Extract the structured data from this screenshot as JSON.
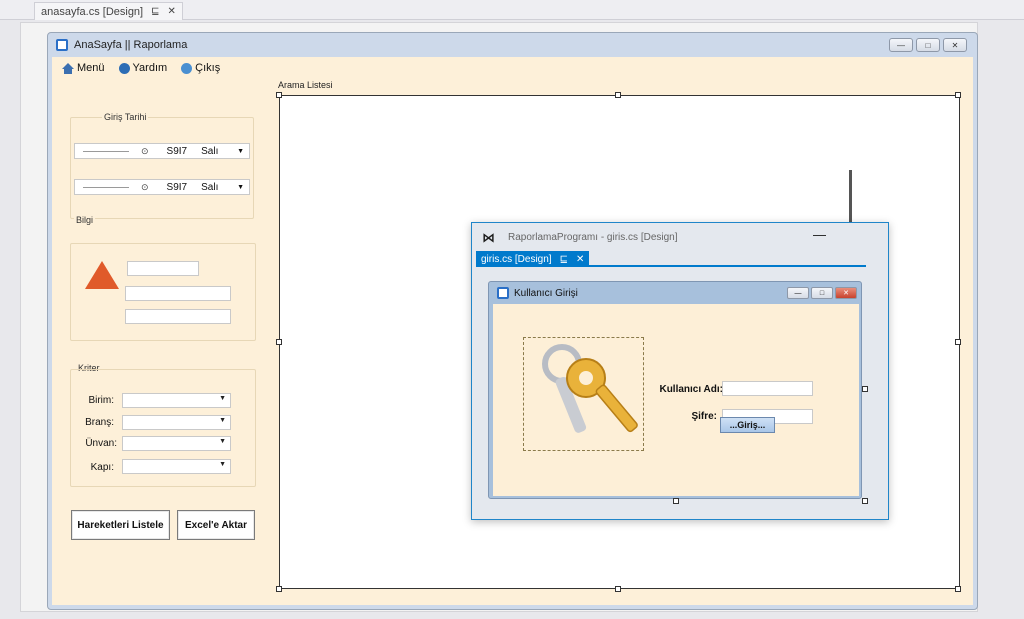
{
  "doc_tab": {
    "label": "anasayfa.cs [Design]",
    "pin": "⊑",
    "close": "✕"
  },
  "main_form": {
    "title": "AnaSayfa || Raporlama",
    "controls": {
      "min": "—",
      "max": "□",
      "close": "✕"
    },
    "menu": [
      {
        "label": "Menü",
        "icon": "home-icon"
      },
      {
        "label": "Yardım",
        "icon": "help-icon"
      },
      {
        "label": "Çıkış",
        "icon": "exit-icon"
      }
    ],
    "tarih_group": {
      "caption": "Giriş Tarihi",
      "rows": [
        {
          "time": "⊙",
          "date": "S9I7",
          "day": "Salı"
        },
        {
          "time": "⊙",
          "date": "S9I7",
          "day": "Salı"
        }
      ]
    },
    "bilgi_group": {
      "caption": "Bilgi"
    },
    "kriter_group": {
      "caption": "Kriter",
      "fields": [
        {
          "label": "Birim:"
        },
        {
          "label": "Branş:"
        },
        {
          "label": "Ünvan:"
        },
        {
          "label": "Kapı:"
        }
      ]
    },
    "buttons": {
      "list": "Hareketleri Listele",
      "export": "Excel'e Aktar"
    },
    "arama_caption": "Arama Listesi"
  },
  "giris_window": {
    "title": "RaporlamaProgramı - giris.cs [Design]",
    "minimize": "—",
    "tab": {
      "label": "giris.cs [Design]",
      "pin": "⊑",
      "close": "✕"
    },
    "login_form": {
      "title": "Kullanıcı Girişi",
      "username_label": "Kullanıcı Adı:",
      "password_label": "Şifre:",
      "button_label": "...Giriş..."
    }
  },
  "colors": {
    "form_bg": "#fdf0d9",
    "window_chrome": "#cdd9ea",
    "vs_accent": "#007acc",
    "warning": "#e05a2a",
    "key_gold": "#e9b23a"
  }
}
